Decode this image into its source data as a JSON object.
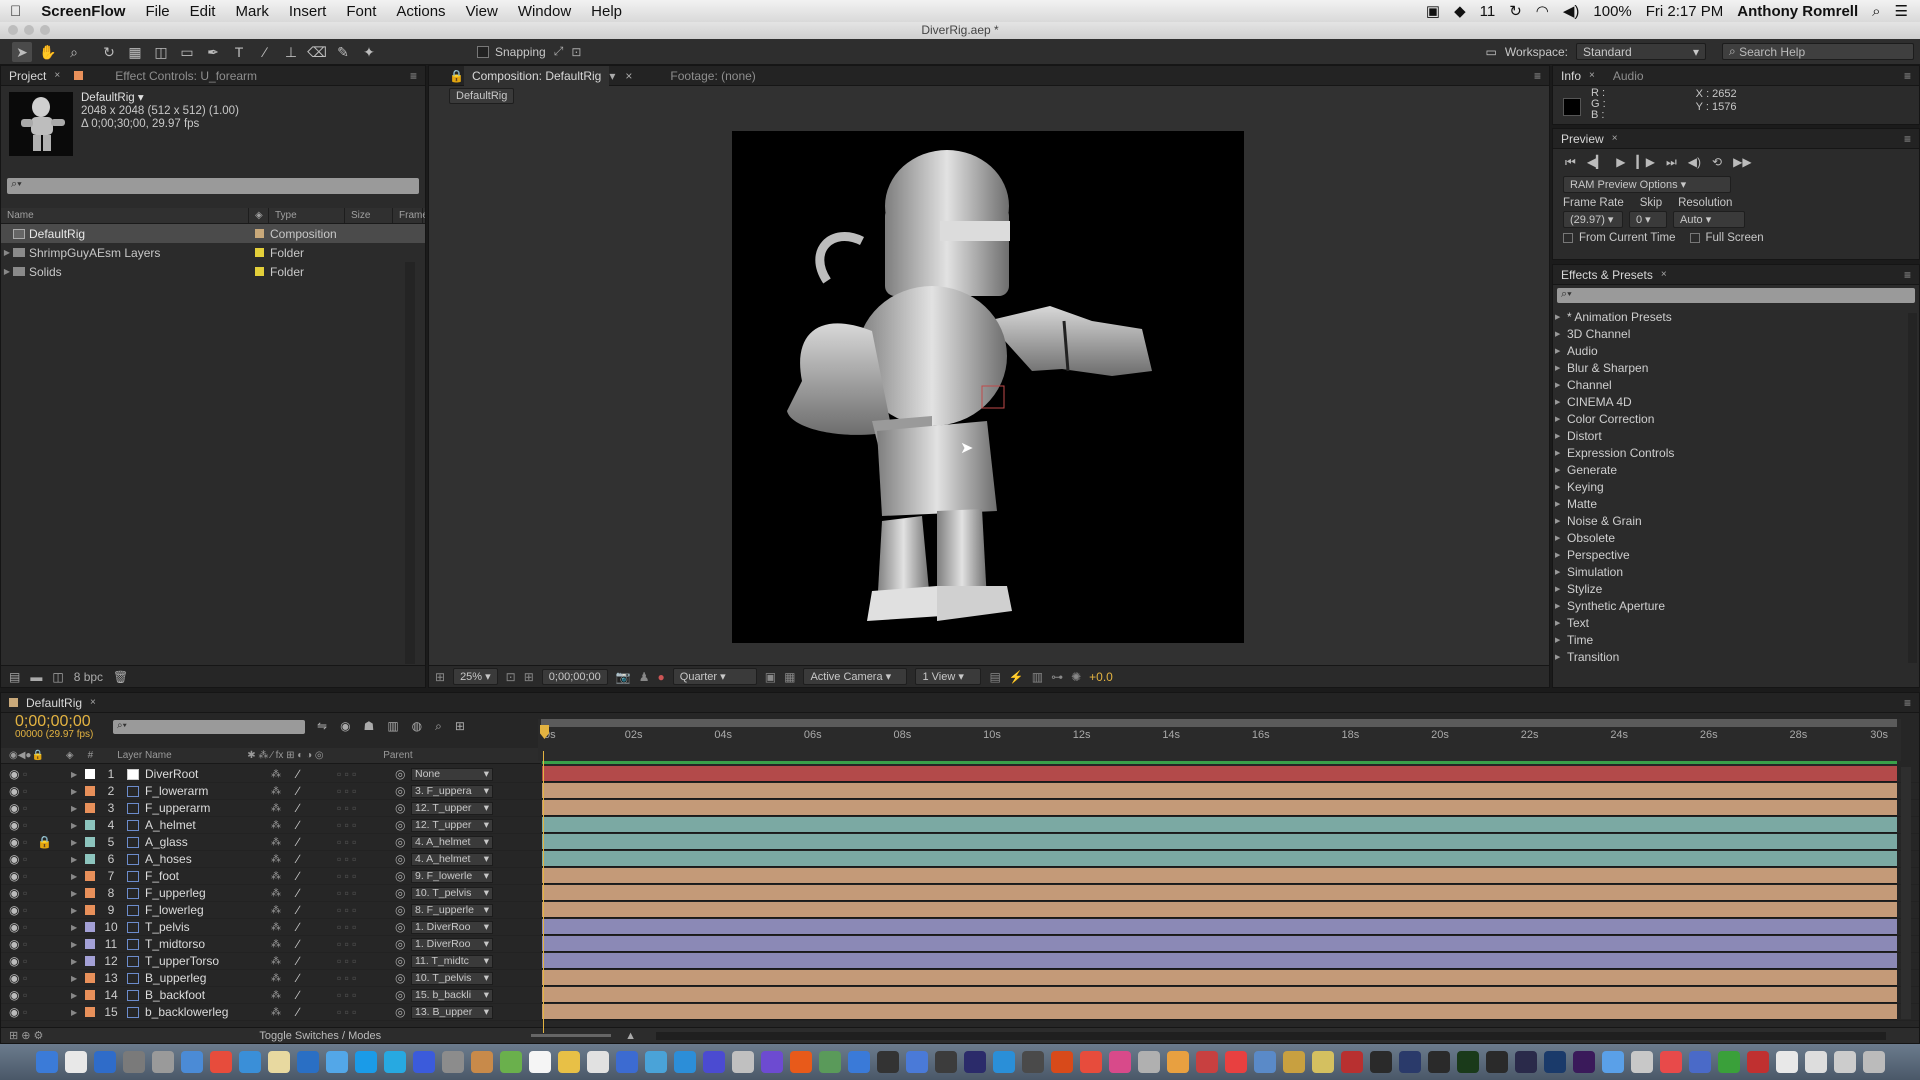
{
  "menubar": {
    "app": "ScreenFlow",
    "items": [
      "File",
      "Edit",
      "Mark",
      "Insert",
      "Font",
      "Actions",
      "View",
      "Window",
      "Help"
    ],
    "status": {
      "notif_count": "11",
      "battery": "100%",
      "clock": "Fri 2:17 PM",
      "user": "Anthony Romrell"
    }
  },
  "window": {
    "title": "DiverRig.aep *"
  },
  "toolbar": {
    "snapping": "Snapping",
    "workspace_label": "Workspace:",
    "workspace_value": "Standard",
    "search_help": "Search Help"
  },
  "project": {
    "tab1": "Project",
    "tab2": "Effect Controls: U_forearm",
    "item_name": "DefaultRig ▾",
    "item_dim": "2048 x 2048  (512 x 512) (1.00)",
    "item_dur": "Δ 0;00;30;00, 29.97 fps",
    "columns": [
      "Name",
      "Type",
      "Size",
      "Frame"
    ],
    "rows": [
      {
        "name": "DefaultRig",
        "type": "Composition",
        "color": "#c9a97a"
      },
      {
        "name": "ShrimpGuyAEsm Layers",
        "type": "Folder",
        "color": "#e3cf3a"
      },
      {
        "name": "Solids",
        "type": "Folder",
        "color": "#e3cf3a"
      }
    ],
    "bpc": "8 bpc"
  },
  "composition": {
    "tab": "Composition: DefaultRig",
    "footage": "Footage: (none)",
    "sub_tab": "DefaultRig",
    "zoom": "25%",
    "timecode": "0;00;00;00",
    "resolution": "Quarter",
    "camera": "Active Camera",
    "views": "1 View",
    "exposure": "+0.0"
  },
  "info": {
    "tab1": "Info",
    "tab2": "Audio",
    "r": "R :",
    "g": "G :",
    "b": "B :",
    "x": "X : 2652",
    "y": "Y : 1576"
  },
  "preview": {
    "tab": "Preview",
    "ram_options": "RAM Preview Options",
    "frame_rate_label": "Frame Rate",
    "skip_label": "Skip",
    "resolution_label": "Resolution",
    "frame_rate": "(29.97)",
    "skip": "0",
    "resolution": "Auto",
    "from_current": "From Current Time",
    "full_screen": "Full Screen"
  },
  "effects": {
    "tab": "Effects & Presets",
    "items": [
      "* Animation Presets",
      "3D Channel",
      "Audio",
      "Blur & Sharpen",
      "Channel",
      "CINEMA 4D",
      "Color Correction",
      "Distort",
      "Expression Controls",
      "Generate",
      "Keying",
      "Matte",
      "Noise & Grain",
      "Obsolete",
      "Perspective",
      "Simulation",
      "Stylize",
      "Synthetic Aperture",
      "Text",
      "Time",
      "Transition"
    ]
  },
  "timeline": {
    "tab": "DefaultRig",
    "timecode": "0;00;00;00",
    "frames": "00000 (29.97 fps)",
    "layer_name_header": "Layer Name",
    "parent_header": "Parent",
    "hash_header": "#",
    "ruler": [
      "0s",
      "02s",
      "04s",
      "06s",
      "08s",
      "10s",
      "12s",
      "14s",
      "16s",
      "18s",
      "20s",
      "22s",
      "24s",
      "26s",
      "28s",
      "30s"
    ],
    "toggle": "Toggle Switches / Modes",
    "layers": [
      {
        "num": "1",
        "name": "DiverRoot",
        "parent": "None",
        "color": "#ffffff",
        "bar": "#b34a4a"
      },
      {
        "num": "2",
        "name": "F_lowerarm",
        "parent": "3. F_uppera",
        "color": "#e8905a",
        "bar": "#c49a78"
      },
      {
        "num": "3",
        "name": "F_upperarm",
        "parent": "12. T_upper",
        "color": "#e8905a",
        "bar": "#c49a78"
      },
      {
        "num": "4",
        "name": "A_helmet",
        "parent": "12. T_upper",
        "color": "#8cc4bd",
        "bar": "#7ba9a3"
      },
      {
        "num": "5",
        "name": "A_glass",
        "parent": "4. A_helmet",
        "color": "#8cc4bd",
        "bar": "#7ba9a3"
      },
      {
        "num": "6",
        "name": "A_hoses",
        "parent": "4. A_helmet",
        "color": "#8cc4bd",
        "bar": "#7ba9a3"
      },
      {
        "num": "7",
        "name": "F_foot",
        "parent": "9. F_lowerle",
        "color": "#e8905a",
        "bar": "#c49a78"
      },
      {
        "num": "8",
        "name": "F_upperleg",
        "parent": "10. T_pelvis",
        "color": "#e8905a",
        "bar": "#c49a78"
      },
      {
        "num": "9",
        "name": "F_lowerleg",
        "parent": "8. F_upperle",
        "color": "#e8905a",
        "bar": "#c49a78"
      },
      {
        "num": "10",
        "name": "T_pelvis",
        "parent": "1. DiverRoo",
        "color": "#a3a0d6",
        "bar": "#8b89b6"
      },
      {
        "num": "11",
        "name": "T_midtorso",
        "parent": "1. DiverRoo",
        "color": "#a3a0d6",
        "bar": "#8b89b6"
      },
      {
        "num": "12",
        "name": "T_upperTorso",
        "parent": "11. T_midtc",
        "color": "#a3a0d6",
        "bar": "#8b89b6"
      },
      {
        "num": "13",
        "name": "B_upperleg",
        "parent": "10. T_pelvis",
        "color": "#e8905a",
        "bar": "#c49a78"
      },
      {
        "num": "14",
        "name": "B_backfoot",
        "parent": "15. b_backli",
        "color": "#e8905a",
        "bar": "#c49a78"
      },
      {
        "num": "15",
        "name": "b_backlowerleg",
        "parent": "13. B_upper",
        "color": "#e8905a",
        "bar": "#c49a78"
      }
    ]
  }
}
